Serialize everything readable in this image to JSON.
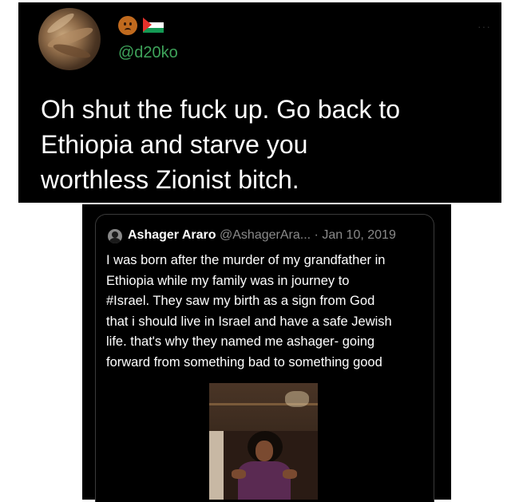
{
  "tweet": {
    "handle": "@d20ko",
    "more_label": "···",
    "body": "Oh shut the fuck up. Go back to\nEthiopia and starve you\nworthless Zionist bitch."
  },
  "quoted_tweet": {
    "display_name": "Ashager Araro",
    "handle": "@AshagerAra...",
    "separator": " · ",
    "date": "Jan 10, 2019",
    "body": "I was born after the murder of my grandfather in\nEthiopia while my family was in journey to\n#Israel. They saw my birth as a sign from God\nthat i should live in Israel and have a safe Jewish\nlife. that's why they named me ashager- going\nforward from something bad to something good"
  },
  "icons": {
    "avatar": "profile-photo",
    "emoji": "frowning-face-emoji",
    "flag": "palestine-flag-emoji",
    "quoted_avatar": "default-profile-avatar",
    "media": "video-thumbnail"
  },
  "colors": {
    "background": "#000000",
    "text": "#ffffff",
    "handle_green": "#3ea35a",
    "muted": "#8a8a8a",
    "border": "#3a3a3a"
  }
}
